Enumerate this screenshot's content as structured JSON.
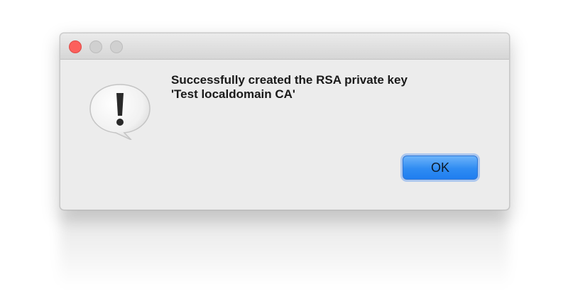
{
  "dialog": {
    "message_line1": "Successfully created the RSA private key",
    "message_line2": "'Test localdomain CA'",
    "ok_label": "OK"
  },
  "icons": {
    "alert": "exclamation-alert-icon",
    "close": "close-button",
    "minimize": "minimize-button",
    "zoom": "zoom-button"
  },
  "colors": {
    "close": "#fc605c",
    "inactive_traffic": "#d0d0d0",
    "accent": "#2f8cf2"
  }
}
